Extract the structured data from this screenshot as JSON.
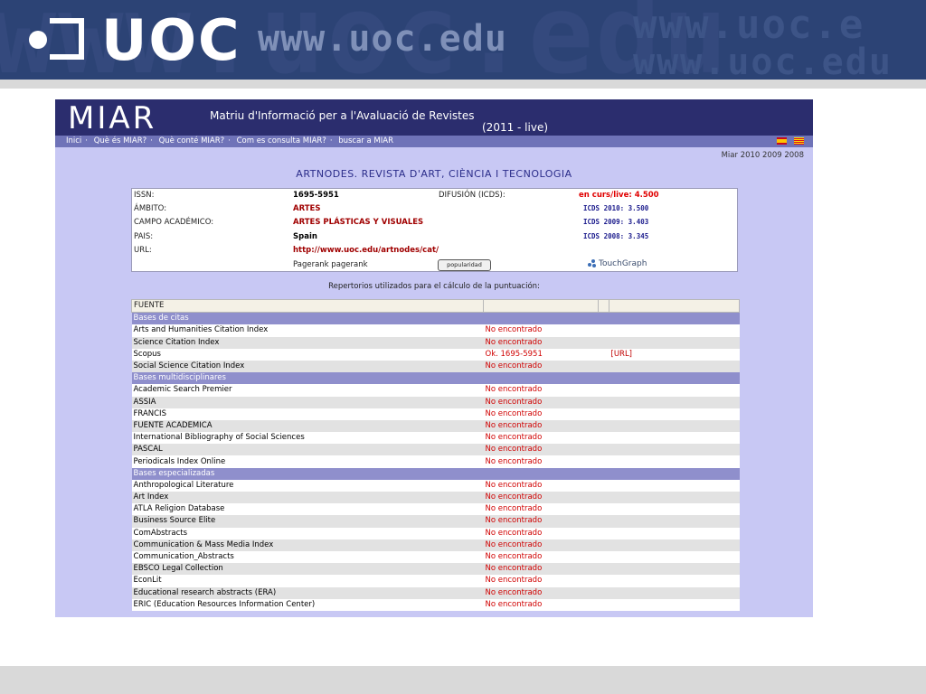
{
  "banner": {
    "logo": "UOC",
    "url": "www.uoc.edu",
    "bg_text_1": "www.uoc.edu",
    "bg_text_2": "www.uoc.e",
    "bg_text_3": "www.uoc.edu",
    "color": "#2c4375"
  },
  "miar": {
    "logo": "MIAR",
    "subtitle": "Matriu d'Informació per a l'Avaluació de Revistes",
    "live_label": "(2011 - live)",
    "nav": [
      "Inici",
      "Què és MIAR?",
      "Què conté MIAR?",
      "Com es consulta MIAR?",
      "buscar a MIAR"
    ],
    "flags": [
      "spanish-flag-icon",
      "catalan-flag-icon"
    ],
    "years": "Miar 2010 2009 2008",
    "journal_title": "ARTNODES. REVISTA D'ART, CIÈNCIA I TECNOLOGIA",
    "info": {
      "issn_label": "ISSN:",
      "issn": "1695-5951",
      "ambito_label": "ÁMBITO:",
      "ambito": "ARTES",
      "campo_label": "CAMPO ACADÉMICO:",
      "campo": "ARTES PLÁSTICAS Y VISUALES",
      "pais_label": "PAIS:",
      "pais": "Spain",
      "url_label": "URL:",
      "url": "http://www.uoc.edu/artnodes/cat/",
      "pagerank": "Pagerank pagerank",
      "difusion_label": "DIFUSIÓN (ICDS):",
      "live_value": "en curs/live: 4.500",
      "icds_2010": "ICDS 2010: 3.500",
      "icds_2009": "ICDS 2009: 3.403",
      "icds_2008": "ICDS 2008: 3.345",
      "popularidad": "popularidad",
      "touchgraph": "TouchGraph"
    },
    "repertorios_title": "Repertorios utilizados para el cálculo de la puntuación:",
    "table_header": "FUENTE"
  },
  "chart_data": {
    "type": "table",
    "columns": [
      "FUENTE",
      "",
      ""
    ],
    "rows": [
      {
        "category": "Bases de citas"
      },
      {
        "fuente": "Arts and Humanities Citation Index",
        "estado": "No encontrado",
        "detalle": ""
      },
      {
        "fuente": "Science Citation Index",
        "estado": "No encontrado",
        "detalle": ""
      },
      {
        "fuente": "Scopus",
        "estado": "Ok. 1695-5951",
        "detalle": "[URL]"
      },
      {
        "fuente": "Social Science Citation Index",
        "estado": "No encontrado",
        "detalle": ""
      },
      {
        "category": "Bases multidisciplinares"
      },
      {
        "fuente": "Academic Search Premier",
        "estado": "No encontrado",
        "detalle": ""
      },
      {
        "fuente": "ASSIA",
        "estado": "No encontrado",
        "detalle": ""
      },
      {
        "fuente": "FRANCIS",
        "estado": "No encontrado",
        "detalle": ""
      },
      {
        "fuente": "FUENTE ACADEMICA",
        "estado": "No encontrado",
        "detalle": ""
      },
      {
        "fuente": "International Bibliography of Social Sciences",
        "estado": "No encontrado",
        "detalle": ""
      },
      {
        "fuente": "PASCAL",
        "estado": "No encontrado",
        "detalle": ""
      },
      {
        "fuente": "Periodicals Index Online",
        "estado": "No encontrado",
        "detalle": ""
      },
      {
        "category": "Bases especializadas"
      },
      {
        "fuente": "Anthropological Literature",
        "estado": "No encontrado",
        "detalle": ""
      },
      {
        "fuente": "Art Index",
        "estado": "No encontrado",
        "detalle": ""
      },
      {
        "fuente": "ATLA Religion Database",
        "estado": "No encontrado",
        "detalle": ""
      },
      {
        "fuente": "Business Source Elite",
        "estado": "No encontrado",
        "detalle": ""
      },
      {
        "fuente": "ComAbstracts",
        "estado": "No encontrado",
        "detalle": ""
      },
      {
        "fuente": "Communication & Mass Media Index",
        "estado": "No encontrado",
        "detalle": ""
      },
      {
        "fuente": "Communication_Abstracts",
        "estado": "No encontrado",
        "detalle": ""
      },
      {
        "fuente": "EBSCO Legal Collection",
        "estado": "No encontrado",
        "detalle": ""
      },
      {
        "fuente": "EconLit",
        "estado": "No encontrado",
        "detalle": ""
      },
      {
        "fuente": "Educational research abstracts (ERA)",
        "estado": "No encontrado",
        "detalle": ""
      },
      {
        "fuente": "ERIC (Education Resources Information Center)",
        "estado": "No encontrado",
        "detalle": ""
      }
    ]
  }
}
